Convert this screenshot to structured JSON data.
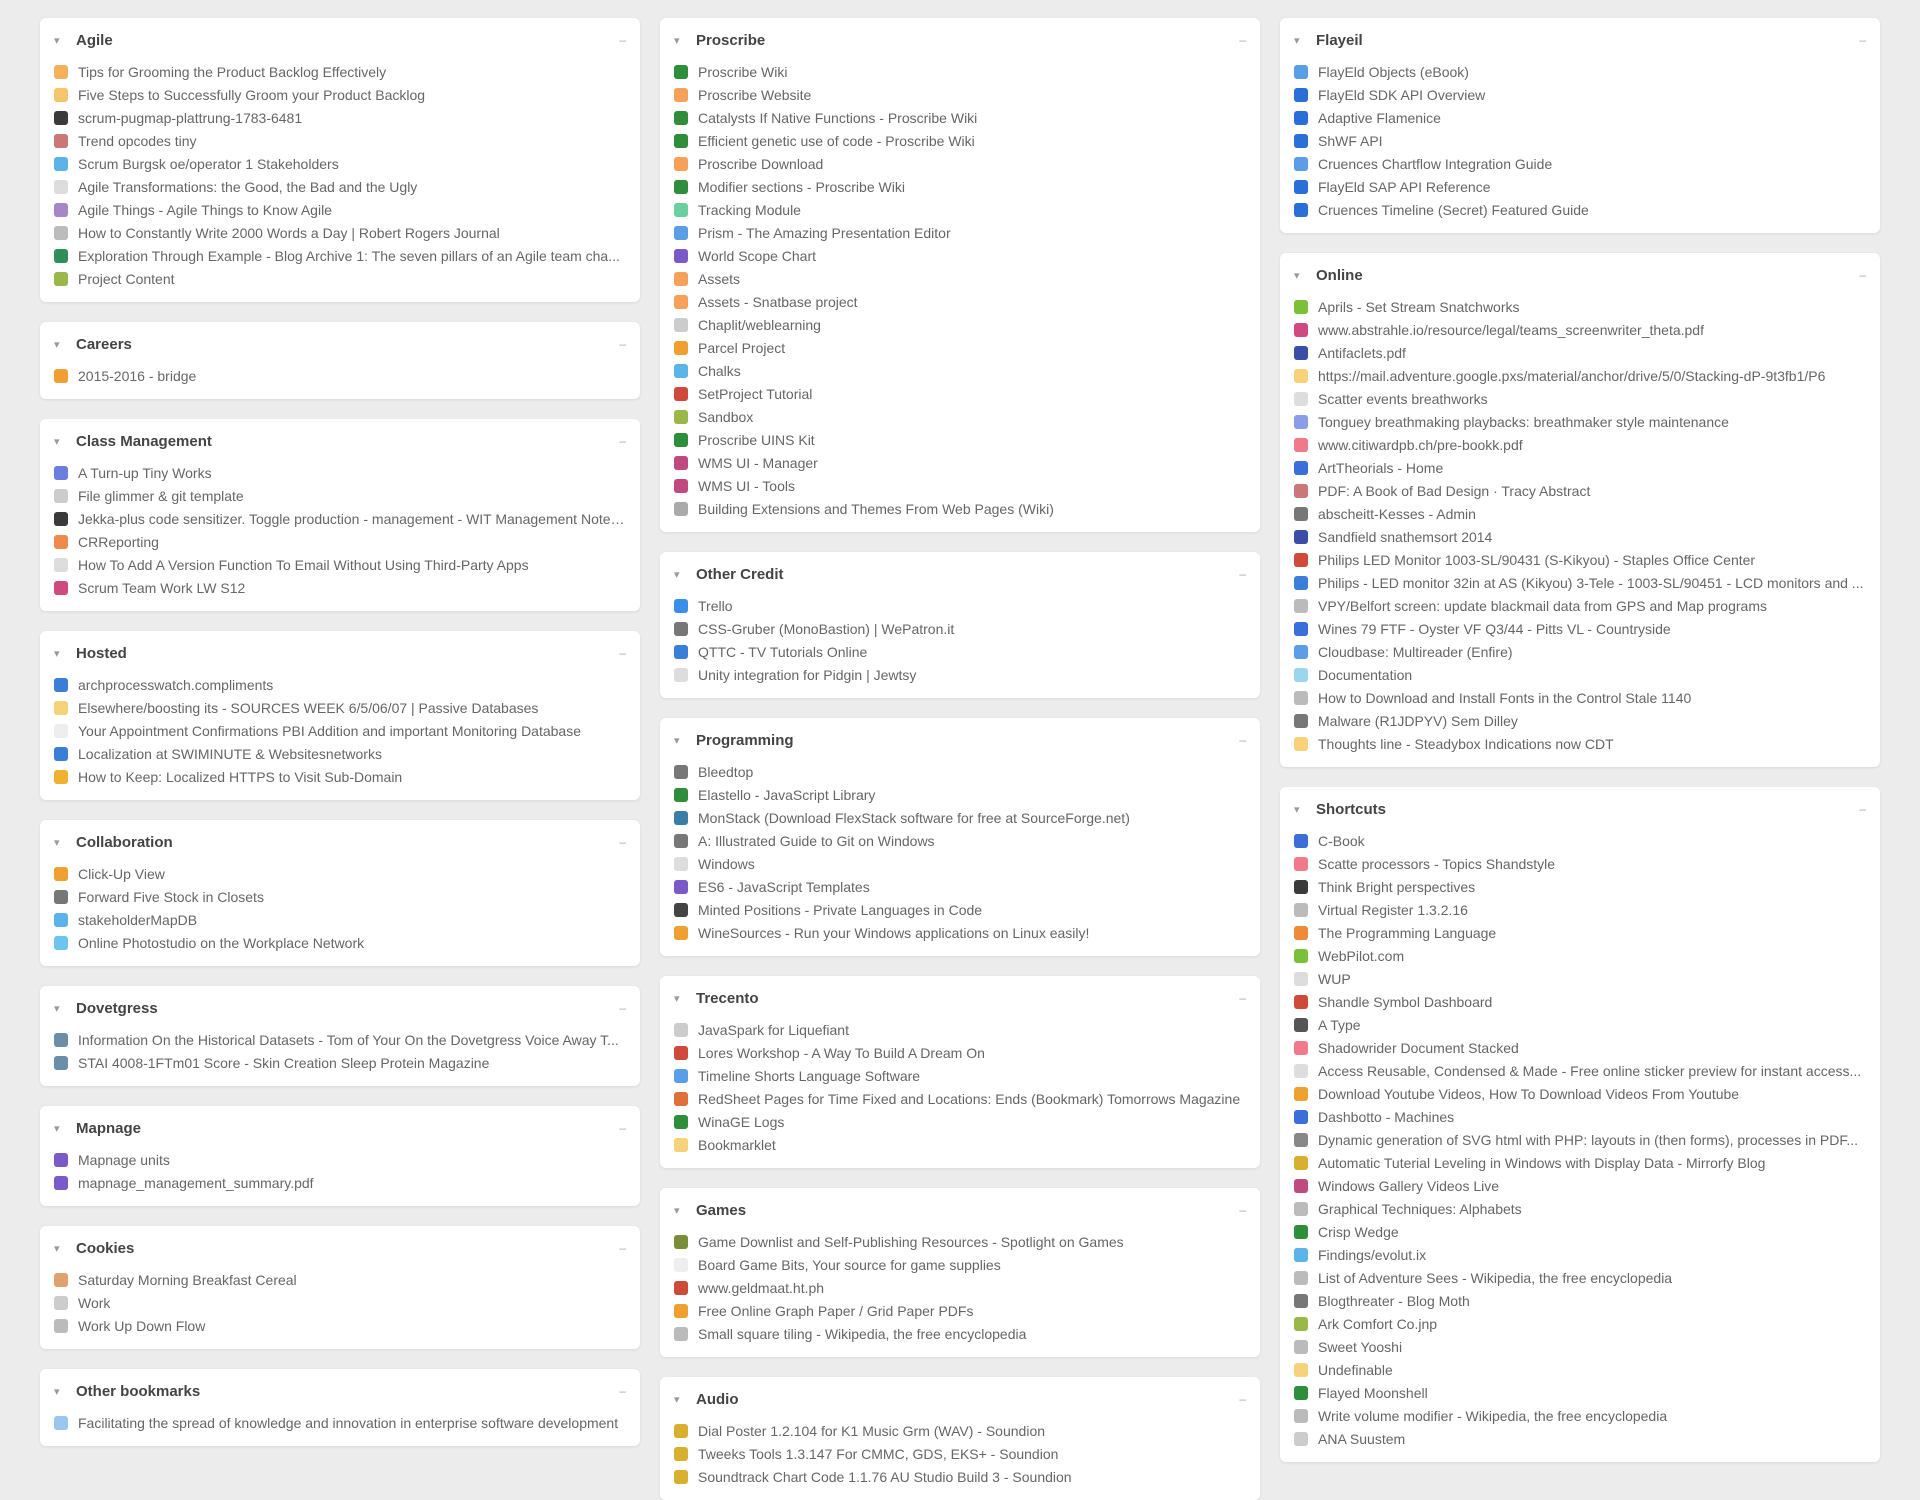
{
  "columns": [
    {
      "cards": [
        {
          "title": "Agile",
          "items": [
            {
              "label": "Tips for Grooming the Product Backlog Effectively",
              "color": "#f6b15a"
            },
            {
              "label": "Five Steps to Successfully Groom your Product Backlog",
              "color": "#f6c56a"
            },
            {
              "label": "scrum-pugmap-plattrung-1783-6481",
              "color": "#3a3a3a"
            },
            {
              "label": "Trend opcodes tiny",
              "color": "#c77"
            },
            {
              "label": "Scrum Burgsk oe/operator 1 Stakeholders",
              "color": "#5cb3e8"
            },
            {
              "label": "Agile Transformations: the Good, the Bad and the Ugly",
              "color": "#ddd"
            },
            {
              "label": "Agile Things - Agile Things to Know Agile",
              "color": "#a785c9"
            },
            {
              "label": "How to Constantly Write 2000 Words a Day | Robert Rogers Journal",
              "color": "#bbb"
            },
            {
              "label": "Exploration Through Example - Blog Archive 1: The seven pillars of an Agile team cha...",
              "color": "#2f8e5a"
            },
            {
              "label": "Project Content",
              "color": "#9ab84a"
            }
          ]
        },
        {
          "title": "Careers",
          "items": [
            {
              "label": "2015-2016 - bridge",
              "color": "#f0a030"
            }
          ]
        },
        {
          "title": "Class Management",
          "items": [
            {
              "label": "A Turn-up Tiny Works",
              "color": "#6a7ee0"
            },
            {
              "label": "File glimmer & git template",
              "color": "#ccc"
            },
            {
              "label": "Jekka-plus code sensitizer. Toggle production - management - WIT Management Notes Hi...",
              "color": "#3a3a3a"
            },
            {
              "label": "CRReporting",
              "color": "#f08a4a"
            },
            {
              "label": "How To Add A Version Function To Email Without Using Third-Party Apps",
              "color": "#ddd"
            },
            {
              "label": "Scrum Team Work LW S12",
              "color": "#d04a80"
            }
          ]
        },
        {
          "title": "Hosted",
          "items": [
            {
              "label": "archprocesswatch.compliments",
              "color": "#3a7ed8"
            },
            {
              "label": "Elsewhere/boosting its - SOURCES WEEK 6/5/06/07 | Passive Databases",
              "color": "#f6d27a"
            },
            {
              "label": "Your Appointment Confirmations PBI Addition and important Monitoring Database",
              "color": "#eee"
            },
            {
              "label": "Localization at SWIMINUTE & Websitesnetworks",
              "color": "#3a7ed8"
            },
            {
              "label": "How to Keep: Localized HTTPS to Visit Sub-Domain",
              "color": "#f0b030"
            }
          ]
        },
        {
          "title": "Collaboration",
          "items": [
            {
              "label": "Click-Up View",
              "color": "#f0a030"
            },
            {
              "label": "Forward Five Stock in Closets",
              "color": "#777"
            },
            {
              "label": "stakeholderMapDB",
              "color": "#5cb3e8"
            },
            {
              "label": "Online Photostudio on the Workplace Network",
              "color": "#6cc4ef"
            }
          ]
        },
        {
          "title": "Dovetgress",
          "items": [
            {
              "label": "Information On the Historical Datasets - Tom of Your On the Dovetgress Voice Away T...",
              "color": "#6a8ea8"
            },
            {
              "label": "STAI 4008-1FTm01 Score - Skin Creation Sleep Protein Magazine",
              "color": "#6a8ea8"
            }
          ]
        },
        {
          "title": "Mapnage",
          "items": [
            {
              "label": "Mapnage units",
              "color": "#7a5ac8"
            },
            {
              "label": "mapnage_management_summary.pdf",
              "color": "#7a5ac8"
            }
          ]
        },
        {
          "title": "Cookies",
          "items": [
            {
              "label": "Saturday Morning Breakfast Cereal",
              "color": "#e0a070"
            },
            {
              "label": "Work",
              "color": "#ccc"
            },
            {
              "label": "Work Up Down Flow",
              "color": "#bbb"
            }
          ]
        },
        {
          "title": "Other bookmarks",
          "items": [
            {
              "label": "Facilitating the spread of knowledge and innovation in enterprise software development",
              "color": "#9bc6ef"
            }
          ]
        }
      ]
    },
    {
      "cards": [
        {
          "title": "Proscribe",
          "items": [
            {
              "label": "Proscribe Wiki",
              "color": "#2f8e3a"
            },
            {
              "label": "Proscribe Website",
              "color": "#f6a05a"
            },
            {
              "label": "Catalysts If Native Functions - Proscribe Wiki",
              "color": "#2f8e3a"
            },
            {
              "label": "Efficient genetic use of code - Proscribe Wiki",
              "color": "#2f8e3a"
            },
            {
              "label": "Proscribe Download",
              "color": "#f6a05a"
            },
            {
              "label": "Modifier sections - Proscribe Wiki",
              "color": "#2f8e3a"
            },
            {
              "label": "Tracking Module",
              "color": "#6ad0a0"
            },
            {
              "label": "Prism - The Amazing Presentation Editor",
              "color": "#5a9ee8"
            },
            {
              "label": "World Scope Chart",
              "color": "#7a5ac8"
            },
            {
              "label": "Assets",
              "color": "#f6a05a"
            },
            {
              "label": "Assets - Snatbase project",
              "color": "#f6a05a"
            },
            {
              "label": "Chaplit/weblearning",
              "color": "#ccc"
            },
            {
              "label": "Parcel Project",
              "color": "#f0a030"
            },
            {
              "label": "Chalks",
              "color": "#5cb3e8"
            },
            {
              "label": "SetProject Tutorial",
              "color": "#d04a3a"
            },
            {
              "label": "Sandbox",
              "color": "#9ab84a"
            },
            {
              "label": "Proscribe UINS Kit",
              "color": "#2f8e3a"
            },
            {
              "label": "WMS UI - Manager",
              "color": "#c04a80"
            },
            {
              "label": "WMS UI - Tools",
              "color": "#c04a80"
            },
            {
              "label": "Building Extensions and Themes From Web Pages (Wiki)",
              "color": "#aaa"
            }
          ]
        },
        {
          "title": "Other Credit",
          "items": [
            {
              "label": "Trello",
              "color": "#3a8ee8"
            },
            {
              "label": "CSS-Gruber (MonoBastion) | WePatron.it",
              "color": "#777"
            },
            {
              "label": "QTTC - TV Tutorials Online",
              "color": "#3a7ed8"
            },
            {
              "label": "Unity integration for Pidgin | Jewtsy",
              "color": "#ddd"
            }
          ]
        },
        {
          "title": "Programming",
          "items": [
            {
              "label": "Bleedtop",
              "color": "#777"
            },
            {
              "label": "Elastello - JavaScript Library",
              "color": "#2f8e3a"
            },
            {
              "label": "MonStack (Download FlexStack software for free at SourceForge.net)",
              "color": "#3a7ea8"
            },
            {
              "label": "A: Illustrated Guide to Git on Windows",
              "color": "#777"
            },
            {
              "label": "Windows",
              "color": "#ddd"
            },
            {
              "label": "ES6 - JavaScript Templates",
              "color": "#7a5ac8"
            },
            {
              "label": "Minted Positions - Private Languages in Code",
              "color": "#444"
            },
            {
              "label": "WineSources - Run your Windows applications on Linux easily!",
              "color": "#f0a030"
            }
          ]
        },
        {
          "title": "Trecento",
          "items": [
            {
              "label": "JavaSpark for Liquefiant",
              "color": "#ccc"
            },
            {
              "label": "Lores Workshop - A Way To Build A Dream On",
              "color": "#d04a3a"
            },
            {
              "label": "Timeline Shorts Language Software",
              "color": "#5a9ee8"
            },
            {
              "label": "RedSheet Pages for Time Fixed and Locations: Ends (Bookmark) Tomorrows Magazine",
              "color": "#e0703a"
            },
            {
              "label": "WinaGE Logs",
              "color": "#2f8e3a"
            },
            {
              "label": "Bookmarklet",
              "color": "#f6d27a"
            }
          ]
        },
        {
          "title": "Games",
          "items": [
            {
              "label": "Game Downlist and Self-Publishing Resources - Spotlight on Games",
              "color": "#7a8e3a"
            },
            {
              "label": "Board Game Bits, Your source for game supplies",
              "color": "#eee"
            },
            {
              "label": "www.geldmaat.ht.ph",
              "color": "#d04a3a"
            },
            {
              "label": "Free Online Graph Paper / Grid Paper PDFs",
              "color": "#f0a030"
            },
            {
              "label": "Small square tiling - Wikipedia, the free encyclopedia",
              "color": "#bbb"
            }
          ]
        },
        {
          "title": "Audio",
          "items": [
            {
              "label": "Dial Poster 1.2.104 for K1 Music Grm (WAV) - Soundion",
              "color": "#d8b030"
            },
            {
              "label": "Tweeks Tools 1.3.147 For CMMC, GDS, EKS+ - Soundion",
              "color": "#d8b030"
            },
            {
              "label": "Soundtrack Chart Code 1.1.76 AU Studio Build 3 - Soundion",
              "color": "#d8b030"
            }
          ]
        }
      ]
    },
    {
      "cards": [
        {
          "title": "Flayeil",
          "items": [
            {
              "label": "FlayEld Objects (eBook)",
              "color": "#5a9ee8"
            },
            {
              "label": "FlayEld SDK API Overview",
              "color": "#2a6ed8"
            },
            {
              "label": "Adaptive Flamenice",
              "color": "#2a6ed8"
            },
            {
              "label": "ShWF API",
              "color": "#2a6ed8"
            },
            {
              "label": "Cruences Chartflow Integration Guide",
              "color": "#5a9ee8"
            },
            {
              "label": "FlayEld SAP API Reference",
              "color": "#2a6ed8"
            },
            {
              "label": "Cruences Timeline (Secret) Featured Guide",
              "color": "#2a6ed8"
            }
          ]
        },
        {
          "title": "Online",
          "items": [
            {
              "label": "Aprils - Set Stream Snatchworks",
              "color": "#7ac03a"
            },
            {
              "label": "www.abstrahle.io/resource/legal/teams_screenwriter_theta.pdf",
              "color": "#d04a80"
            },
            {
              "label": "Antifaclets.pdf",
              "color": "#3a4ea8"
            },
            {
              "label": "https://mail.adventure.google.pxs/material/anchor/drive/5/0/Stacking-dP-9t3fb1/P6",
              "color": "#f6d27a"
            },
            {
              "label": "Scatter events breathworks",
              "color": "#ddd"
            },
            {
              "label": "Tonguey breathmaking playbacks: breathmaker style maintenance",
              "color": "#8a9ee8"
            },
            {
              "label": "www.citiwardpb.ch/pre-bookk.pdf",
              "color": "#f07a8a"
            },
            {
              "label": "ArtTheorials - Home",
              "color": "#3a6ed8"
            },
            {
              "label": "PDF: A Book of Bad Design · Tracy Abstract",
              "color": "#c77"
            },
            {
              "label": "abscheitt-Kesses - Admin",
              "color": "#777"
            },
            {
              "label": "Sandfield snathemsort 2014",
              "color": "#3a4ea8"
            },
            {
              "label": "Philips LED Monitor 1003-SL/90431 (S-Kikyou) - Staples Office Center",
              "color": "#d04a3a"
            },
            {
              "label": "Philips - LED monitor 32in at AS (Kikyou) 3-Tele - 1003-SL/90451 - LCD monitors and ...",
              "color": "#3a7ed8"
            },
            {
              "label": "VPY/Belfort screen: update blackmail data from GPS and Map programs",
              "color": "#bbb"
            },
            {
              "label": "Wines 79 FTF - Oyster VF Q3/44 - Pitts VL - Countryside",
              "color": "#3a6ed8"
            },
            {
              "label": "Cloudbase: Multireader (Enfire)",
              "color": "#5a9ee8"
            },
            {
              "label": "Documentation",
              "color": "#9bd6ef"
            },
            {
              "label": "How to Download and Install Fonts in the Control Stale 1140",
              "color": "#bbb"
            },
            {
              "label": "Malware (R1JDPYV) Sem Dilley",
              "color": "#777"
            },
            {
              "label": "Thoughts line - Steadybox Indications now CDT",
              "color": "#f6d27a"
            }
          ]
        },
        {
          "title": "Shortcuts",
          "items": [
            {
              "label": "C-Book",
              "color": "#3a6ed8"
            },
            {
              "label": "Scatte processors - Topics Shandstyle",
              "color": "#f07a8a"
            },
            {
              "label": "Think Bright perspectives",
              "color": "#3a3a3a"
            },
            {
              "label": "Virtual Register 1.3.2.16",
              "color": "#bbb"
            },
            {
              "label": "The Programming Language",
              "color": "#f08a3a"
            },
            {
              "label": "WebPilot.com",
              "color": "#7ac03a"
            },
            {
              "label": "WUP",
              "color": "#ddd"
            },
            {
              "label": "Shandle Symbol Dashboard",
              "color": "#d04a3a"
            },
            {
              "label": "A Type",
              "color": "#555"
            },
            {
              "label": "Shadowrider Document Stacked",
              "color": "#f07a8a"
            },
            {
              "label": "Access Reusable, Condensed & Made - Free online sticker preview for instant access...",
              "color": "#ddd"
            },
            {
              "label": "Download Youtube Videos, How To Download Videos From Youtube",
              "color": "#f0a030"
            },
            {
              "label": "Dashbotto - Machines",
              "color": "#3a6ed8"
            },
            {
              "label": "Dynamic generation of SVG html with PHP: layouts in (then forms), processes in PDF...",
              "color": "#888"
            },
            {
              "label": "Automatic Tuterial Leveling in Windows with Display Data - Mirrorfy Blog",
              "color": "#d8b030"
            },
            {
              "label": "Windows Gallery Videos Live",
              "color": "#c04a80"
            },
            {
              "label": "Graphical Techniques: Alphabets",
              "color": "#bbb"
            },
            {
              "label": "Crisp Wedge",
              "color": "#2f8e3a"
            },
            {
              "label": "Findings/evolut.ix",
              "color": "#5cb3e8"
            },
            {
              "label": "List of Adventure Sees - Wikipedia, the free encyclopedia",
              "color": "#bbb"
            },
            {
              "label": "Blogthreater - Blog Moth",
              "color": "#777"
            },
            {
              "label": "Ark Comfort Co.jnp",
              "color": "#9ab84a"
            },
            {
              "label": "Sweet Yooshi",
              "color": "#bbb"
            },
            {
              "label": "Undefinable",
              "color": "#f6d27a"
            },
            {
              "label": "Flayed Moonshell",
              "color": "#2f8e3a"
            },
            {
              "label": "Write volume modifier - Wikipedia, the free encyclopedia",
              "color": "#bbb"
            },
            {
              "label": "ANA Suustem",
              "color": "#ccc"
            }
          ]
        }
      ]
    }
  ]
}
